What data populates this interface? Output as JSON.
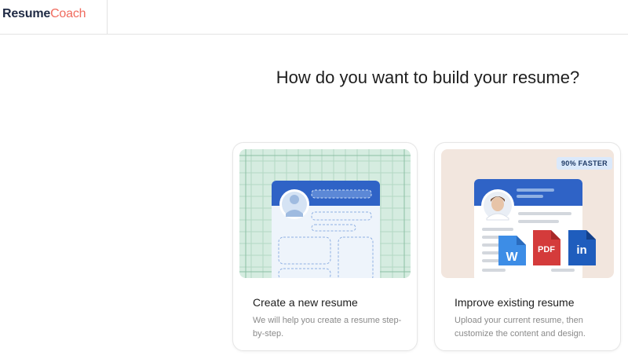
{
  "brand": {
    "part1": "Resume",
    "part2": "Coach"
  },
  "headline": "How do you want to build your resume?",
  "cards": [
    {
      "title": "Create a new resume",
      "description": "We will help you create a resume step-by-step.",
      "illustration": "resume-builder-grid-illustration"
    },
    {
      "title": "Improve existing resume",
      "description": "Upload your current resume, then customize the content and design.",
      "badge": "90% FASTER",
      "illustration": "resume-upload-illustration",
      "file_icons": [
        "W",
        "PDF",
        "in"
      ]
    }
  ],
  "colors": {
    "brand_dark": "#1f2a44",
    "brand_accent": "#f06b5e",
    "resume_header_blue": "#2f63c6",
    "grid_green": "#d5ece0",
    "word_blue": "#3d8de6",
    "pdf_red": "#d43b3b",
    "linkedin_blue": "#1f5dbd"
  }
}
